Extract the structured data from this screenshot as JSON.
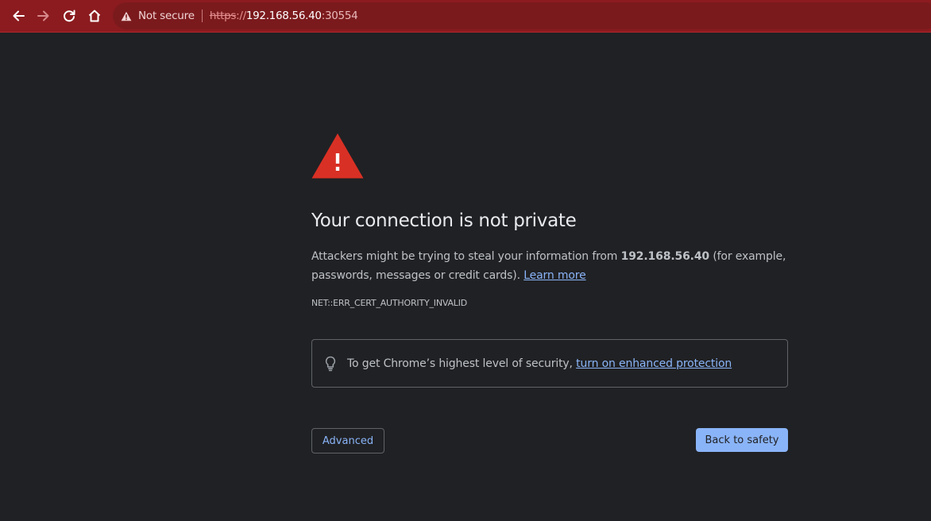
{
  "browser": {
    "security_label": "Not secure",
    "url": {
      "scheme": "https",
      "separator": "://",
      "host": "192.168.56.40",
      "port": ":30554"
    },
    "icons": [
      "back-arrow-icon",
      "forward-arrow-icon",
      "reload-icon",
      "home-icon",
      "warning-triangle-icon"
    ]
  },
  "interstitial": {
    "heading": "Your connection is not private",
    "message_before": "Attackers might be trying to steal your information from ",
    "host": "192.168.56.40",
    "message_after": " (for example, passwords, messages or credit cards). ",
    "learn_more": "Learn more",
    "error_code": "NET::ERR_CERT_AUTHORITY_INVALID",
    "enhanced_prefix": "To get Chrome’s highest level of security, ",
    "enhanced_link": "turn on enhanced protection",
    "advanced_button": "Advanced",
    "back_button": "Back to safety"
  },
  "colors": {
    "toolbar": "#8b1b1f",
    "page_background": "#202124",
    "warning_red": "#d93025",
    "link_blue": "#8ab4f8"
  }
}
